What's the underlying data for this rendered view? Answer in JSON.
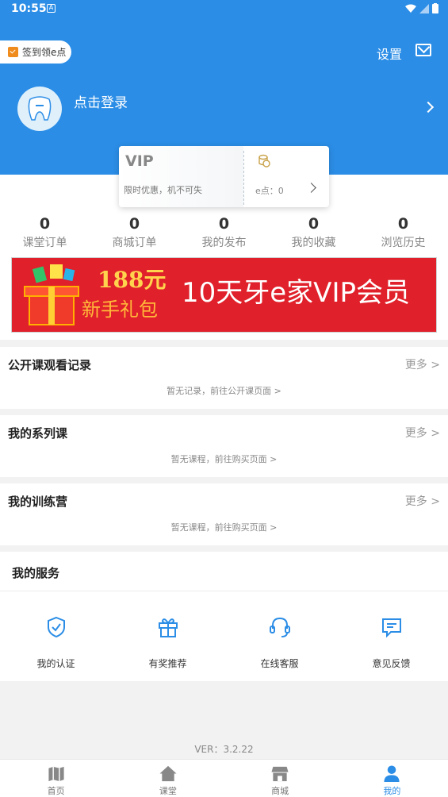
{
  "status": {
    "time": "10:55"
  },
  "header": {
    "signin_label": "签到领e点",
    "settings_label": "设置",
    "login_label": "点击登录"
  },
  "vip_card": {
    "title": "VIP",
    "subtitle": "限时优惠，机不可失",
    "points_label": "e点：0"
  },
  "stats": [
    {
      "value": "0",
      "label": "课堂订单"
    },
    {
      "value": "0",
      "label": "商城订单"
    },
    {
      "value": "0",
      "label": "我的发布"
    },
    {
      "value": "0",
      "label": "我的收藏"
    },
    {
      "value": "0",
      "label": "浏览历史"
    }
  ],
  "banner": {
    "price": "188元",
    "gift": "新手礼包",
    "vip_text": "10天牙e家VIP会员"
  },
  "sections": [
    {
      "title": "公开课观看记录",
      "more": "更多 >",
      "empty": "暂无记录，前往公开课页面 >"
    },
    {
      "title": "我的系列课",
      "more": "更多 >",
      "empty": "暂无课程，前往购买页面 >"
    },
    {
      "title": "我的训练营",
      "more": "更多 >",
      "empty": "暂无课程，前往购买页面 >"
    }
  ],
  "services": {
    "title": "我的服务",
    "items": [
      {
        "label": "我的认证",
        "icon": "shield-check-icon"
      },
      {
        "label": "有奖推荐",
        "icon": "gift-icon"
      },
      {
        "label": "在线客服",
        "icon": "headset-icon"
      },
      {
        "label": "意见反馈",
        "icon": "feedback-icon"
      }
    ]
  },
  "version": "VER：3.2.22",
  "tabbar": [
    {
      "label": "首页",
      "icon": "map-icon",
      "active": false
    },
    {
      "label": "课堂",
      "icon": "home-icon",
      "active": false
    },
    {
      "label": "商城",
      "icon": "store-icon",
      "active": false
    },
    {
      "label": "我的",
      "icon": "person-icon",
      "active": true
    }
  ],
  "colors": {
    "primary": "#2b8de6",
    "banner_red": "#e0202a"
  }
}
